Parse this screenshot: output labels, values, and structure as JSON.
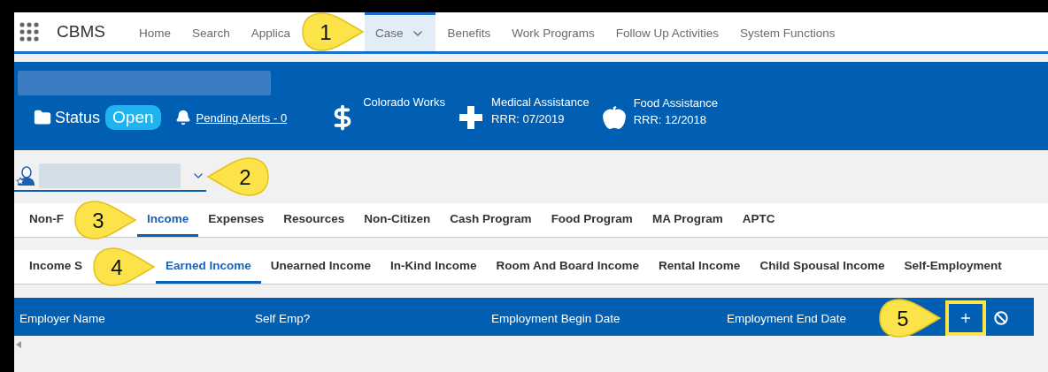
{
  "app": {
    "name": "CBMS"
  },
  "nav": [
    {
      "label": "Home",
      "selected": false
    },
    {
      "label": "Search",
      "selected": false
    },
    {
      "label": "Applica",
      "selected": false,
      "callout": "1"
    },
    {
      "label": "Case",
      "selected": true,
      "has_menu": true
    },
    {
      "label": "Benefits",
      "selected": false
    },
    {
      "label": "Work Programs",
      "selected": false
    },
    {
      "label": "Follow Up Activities",
      "selected": false
    },
    {
      "label": "System Functions",
      "selected": false
    }
  ],
  "case_header": {
    "status_label": "Status",
    "status_value": "Open",
    "alerts_link": "Pending Alerts - 0",
    "programs": [
      {
        "kind": "cash",
        "name": "Colorado Works"
      },
      {
        "kind": "medical",
        "name": "Medical Assistance",
        "rrr": "RRR: 07/2019"
      },
      {
        "kind": "food",
        "name": "Food Assistance",
        "rrr": "RRR: 12/2018"
      }
    ]
  },
  "person_select": {
    "callout": "2"
  },
  "section_tabs": [
    {
      "label": "Non-F",
      "selected": false,
      "callout": "3"
    },
    {
      "label": "Income",
      "selected": true
    },
    {
      "label": "Expenses",
      "selected": false
    },
    {
      "label": "Resources",
      "selected": false
    },
    {
      "label": "Non-Citizen",
      "selected": false
    },
    {
      "label": "Cash Program",
      "selected": false
    },
    {
      "label": "Food Program",
      "selected": false
    },
    {
      "label": "MA Program",
      "selected": false
    },
    {
      "label": "APTC",
      "selected": false
    }
  ],
  "income_tabs": [
    {
      "label": "Income S",
      "selected": false,
      "callout": "4"
    },
    {
      "label": "Earned Income",
      "selected": true
    },
    {
      "label": "Unearned Income",
      "selected": false
    },
    {
      "label": "In-Kind Income",
      "selected": false
    },
    {
      "label": "Room And Board Income",
      "selected": false
    },
    {
      "label": "Rental Income",
      "selected": false
    },
    {
      "label": "Child Spousal Income",
      "selected": false
    },
    {
      "label": "Self-Employment",
      "selected": false
    }
  ],
  "table": {
    "columns": [
      "Employer Name",
      "Self Emp?",
      "Employment Begin Date",
      "Employment End Date"
    ],
    "actions": [
      {
        "kind": "add",
        "highlighted": true,
        "callout": "5"
      },
      {
        "kind": "clear",
        "highlighted": false
      }
    ]
  }
}
